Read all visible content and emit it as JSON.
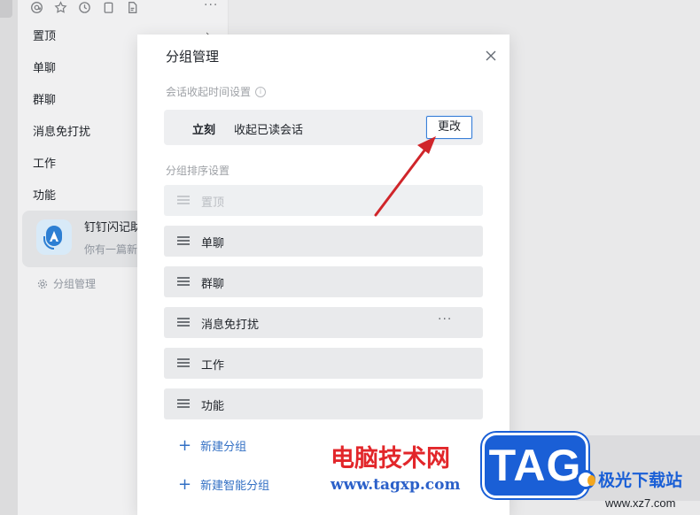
{
  "sidebar": {
    "more_label": "···",
    "items": [
      {
        "label": "置顶"
      },
      {
        "label": "单聊"
      },
      {
        "label": "群聊"
      },
      {
        "label": "消息免打扰"
      },
      {
        "label": "工作"
      },
      {
        "label": "功能"
      }
    ],
    "card": {
      "title": "钉钉闪记助",
      "subtitle": "你有一篇新"
    },
    "group_manage_label": "分组管理"
  },
  "dialog": {
    "title": "分组管理",
    "collapse_section_label": "会话收起时间设置",
    "collapse_timing": "立刻",
    "collapse_action": "收起已读会话",
    "change_button": "更改",
    "sort_section_label": "分组排序设置",
    "groups": [
      {
        "label": "置顶",
        "disabled": true
      },
      {
        "label": "单聊"
      },
      {
        "label": "群聊"
      },
      {
        "label": "消息免打扰",
        "more": "···"
      },
      {
        "label": "工作"
      },
      {
        "label": "功能"
      }
    ],
    "new_group": "新建分组",
    "new_smart_group": "新建智能分组"
  },
  "watermark": {
    "site_cn": "电脑技术网",
    "site_url": "www.tagxp.com",
    "logo": "TAG",
    "brand2": "极光下载站",
    "brand2_url": "www.xz7.com"
  },
  "colors": {
    "accent_blue": "#3370c4",
    "arrow_red": "#d0252a",
    "button_border": "#3b7fd6"
  }
}
